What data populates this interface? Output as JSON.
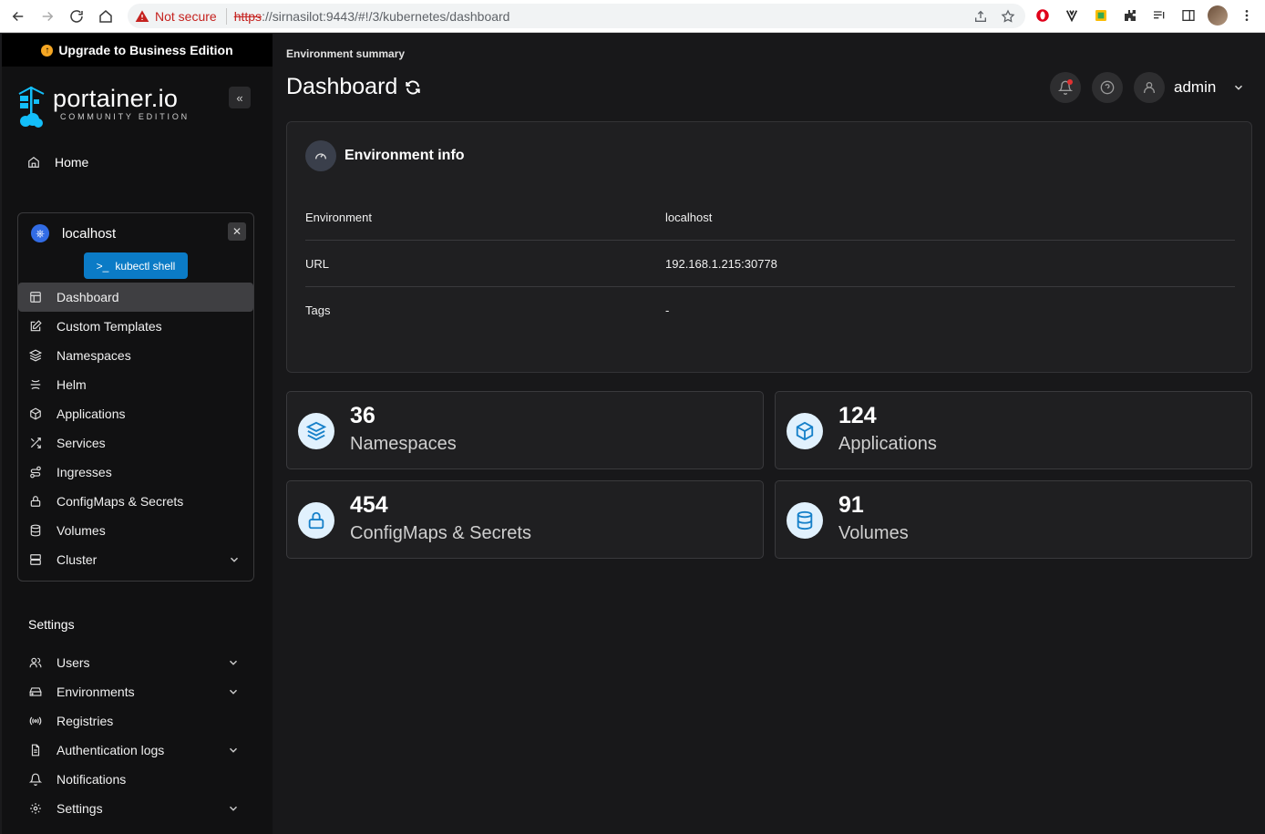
{
  "browser": {
    "security_label": "Not secure",
    "url_scheme": "https",
    "url_rest": "://sirnasilot:9443/#!/3/kubernetes/dashboard"
  },
  "sidebar": {
    "upgrade_label": "Upgrade to Business Edition",
    "brand_name": "portainer.io",
    "brand_sub": "COMMUNITY EDITION",
    "home_label": "Home",
    "environment": {
      "name": "localhost",
      "kubectl_label": "kubectl shell",
      "items": [
        {
          "label": "Dashboard",
          "icon": "layout-icon"
        },
        {
          "label": "Custom Templates",
          "icon": "edit-icon"
        },
        {
          "label": "Namespaces",
          "icon": "layers-icon"
        },
        {
          "label": "Helm",
          "icon": "helm-icon"
        },
        {
          "label": "Applications",
          "icon": "box-icon"
        },
        {
          "label": "Services",
          "icon": "shuffle-icon"
        },
        {
          "label": "Ingresses",
          "icon": "route-icon"
        },
        {
          "label": "ConfigMaps & Secrets",
          "icon": "lock-icon"
        },
        {
          "label": "Volumes",
          "icon": "database-icon"
        },
        {
          "label": "Cluster",
          "icon": "server-icon"
        }
      ]
    },
    "settings_title": "Settings",
    "settings_items": [
      {
        "label": "Users",
        "icon": "users-icon"
      },
      {
        "label": "Environments",
        "icon": "hard-drive-icon"
      },
      {
        "label": "Registries",
        "icon": "radio-icon"
      },
      {
        "label": "Authentication logs",
        "icon": "file-text-icon"
      },
      {
        "label": "Notifications",
        "icon": "bell-icon"
      },
      {
        "label": "Settings",
        "icon": "gear-icon"
      }
    ]
  },
  "main": {
    "breadcrumb": "Environment summary",
    "title": "Dashboard",
    "user": "admin",
    "env_info": {
      "title": "Environment info",
      "rows": [
        {
          "key": "Environment",
          "value": "localhost"
        },
        {
          "key": "URL",
          "value": "192.168.1.215:30778"
        },
        {
          "key": "Tags",
          "value": "-"
        }
      ]
    },
    "stats": [
      {
        "value": "36",
        "label": "Namespaces",
        "icon": "layers-icon"
      },
      {
        "value": "124",
        "label": "Applications",
        "icon": "box-icon"
      },
      {
        "value": "454",
        "label": "ConfigMaps & Secrets",
        "icon": "lock-icon"
      },
      {
        "value": "91",
        "label": "Volumes",
        "icon": "database-icon"
      }
    ]
  }
}
